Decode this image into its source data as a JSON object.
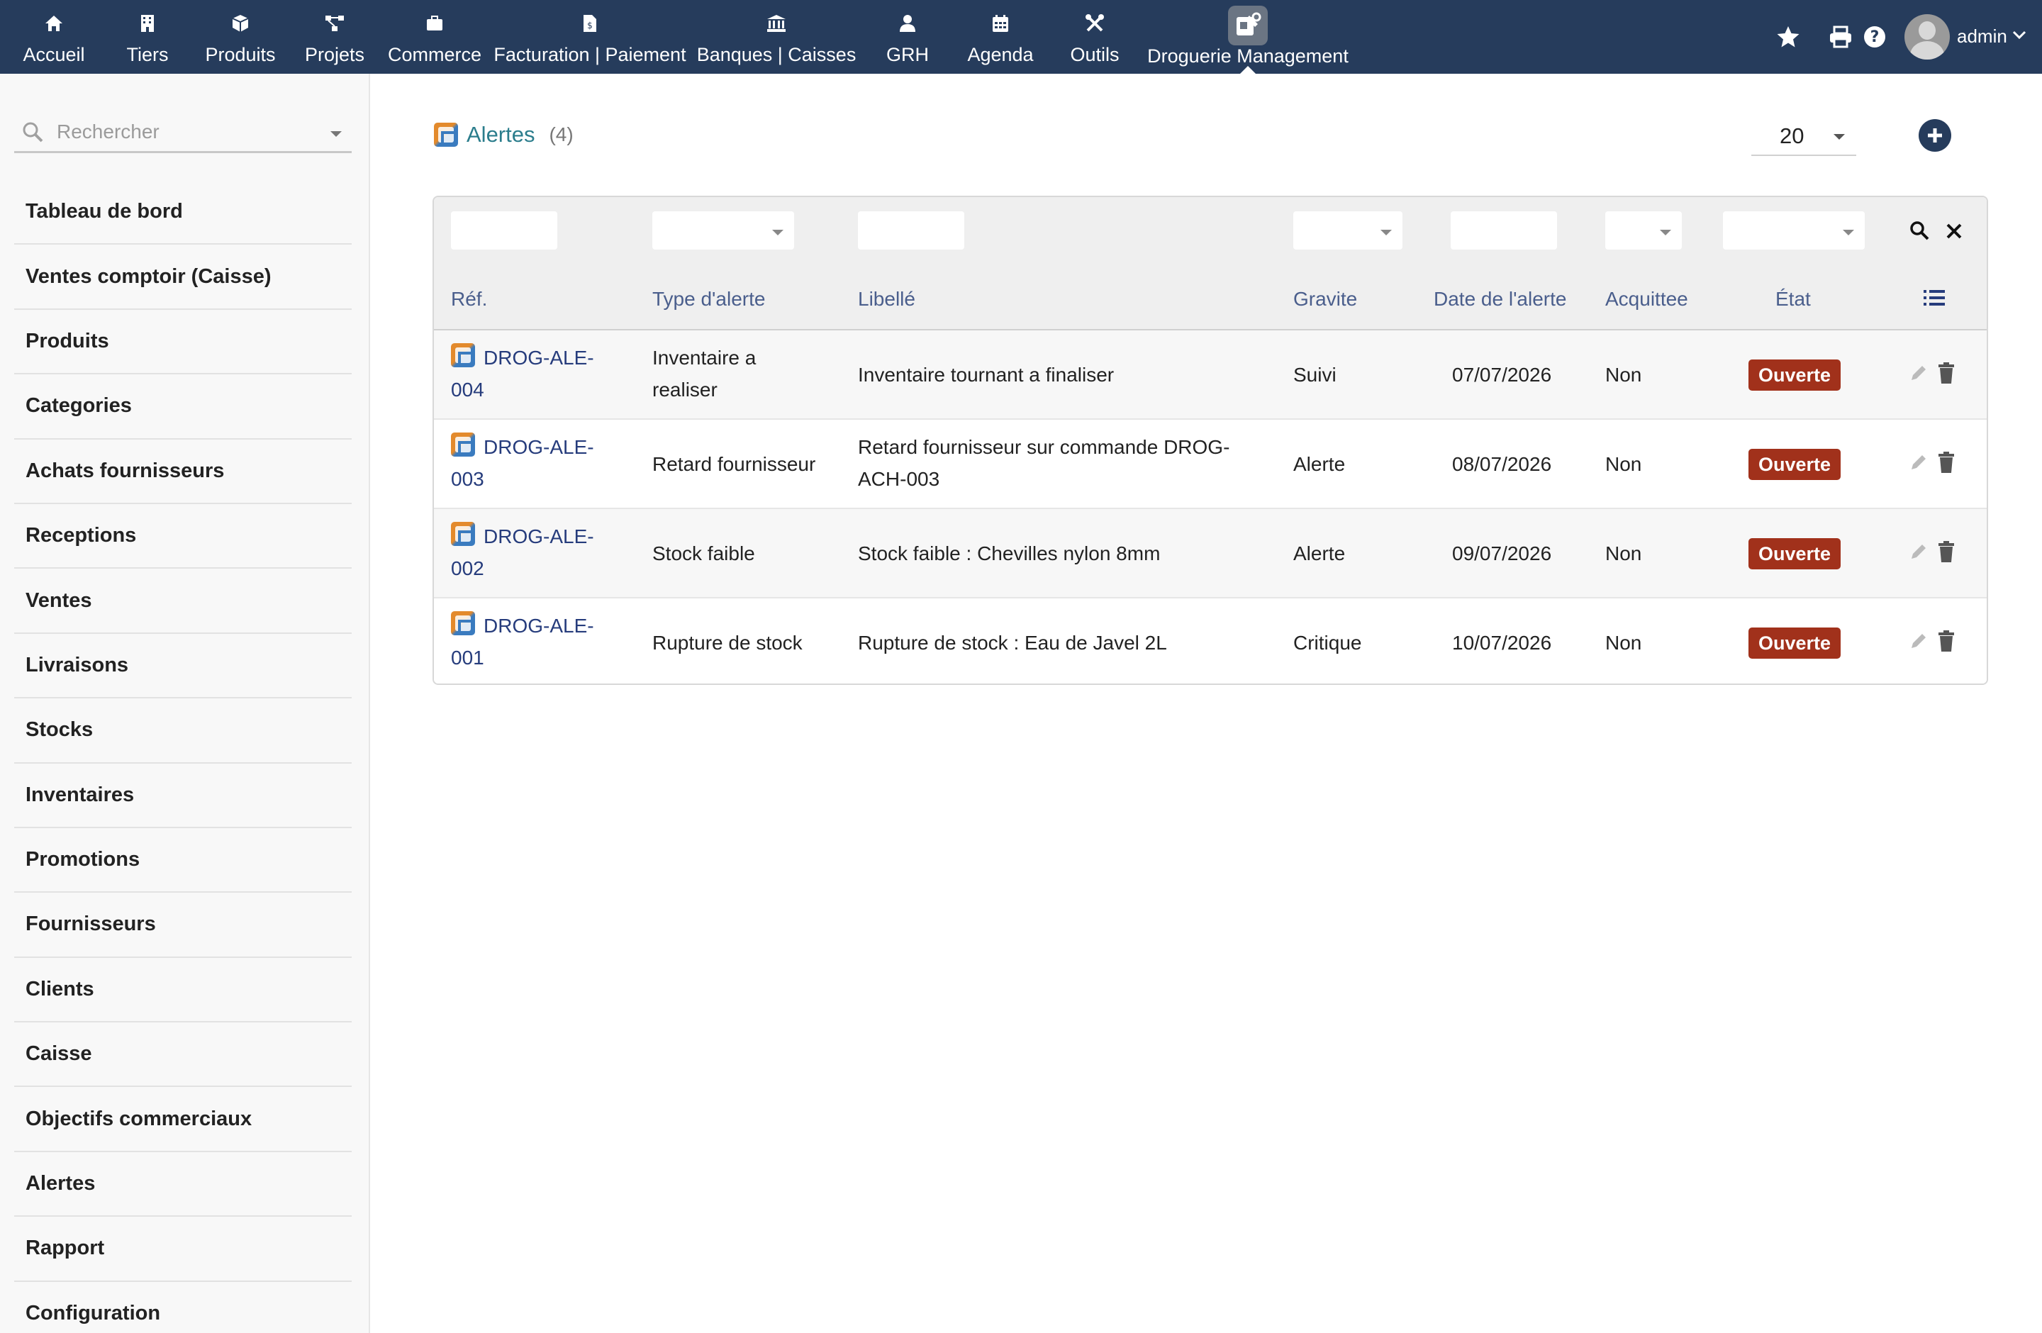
{
  "nav": [
    {
      "label": "Accueil",
      "icon": "home-icon"
    },
    {
      "label": "Tiers",
      "icon": "building-icon"
    },
    {
      "label": "Produits",
      "icon": "cube-icon"
    },
    {
      "label": "Projets",
      "icon": "project-icon"
    },
    {
      "label": "Commerce",
      "icon": "briefcase-icon"
    },
    {
      "label": "Facturation | Paiement",
      "icon": "invoice-icon"
    },
    {
      "label": "Banques | Caisses",
      "icon": "bank-icon"
    },
    {
      "label": "GRH",
      "icon": "user-icon"
    },
    {
      "label": "Agenda",
      "icon": "calendar-icon"
    },
    {
      "label": "Outils",
      "icon": "tools-icon"
    },
    {
      "label": "Droguerie Management",
      "icon": "droguerie-module-icon"
    }
  ],
  "user": {
    "name": "admin"
  },
  "sidebar": {
    "search_placeholder": "Rechercher",
    "items": [
      {
        "label": "Tableau de bord"
      },
      {
        "label": "Ventes comptoir (Caisse)"
      },
      {
        "label": "Produits"
      },
      {
        "label": "Categories"
      },
      {
        "label": "Achats fournisseurs"
      },
      {
        "label": "Receptions"
      },
      {
        "label": "Ventes"
      },
      {
        "label": "Livraisons"
      },
      {
        "label": "Stocks"
      },
      {
        "label": "Inventaires"
      },
      {
        "label": "Promotions"
      },
      {
        "label": "Fournisseurs"
      },
      {
        "label": "Clients"
      },
      {
        "label": "Caisse"
      },
      {
        "label": "Objectifs commerciaux"
      },
      {
        "label": "Alertes"
      },
      {
        "label": "Rapport"
      },
      {
        "label": "Configuration"
      }
    ]
  },
  "page": {
    "title": "Alertes",
    "count": "(4)",
    "page_size": "20"
  },
  "table": {
    "headers": {
      "ref": "Réf.",
      "type": "Type d'alerte",
      "libelle": "Libellé",
      "gravite": "Gravite",
      "date": "Date de l'alerte",
      "acquittee": "Acquittee",
      "etat": "État"
    },
    "rows": [
      {
        "ref_line1": "DROG-ALE-",
        "ref_line2": "004",
        "type_line1": "Inventaire a",
        "type_line2": "realiser",
        "libelle_line1": "Inventaire tournant a finaliser",
        "libelle_line2": "",
        "gravite": "Suivi",
        "date": "07/07/2026",
        "acquittee": "Non",
        "etat": "Ouverte"
      },
      {
        "ref_line1": "DROG-ALE-",
        "ref_line2": "003",
        "type_line1": "Retard fournisseur",
        "type_line2": "",
        "libelle_line1": "Retard fournisseur sur commande DROG-",
        "libelle_line2": "ACH-003",
        "gravite": "Alerte",
        "date": "08/07/2026",
        "acquittee": "Non",
        "etat": "Ouverte"
      },
      {
        "ref_line1": "DROG-ALE-",
        "ref_line2": "002",
        "type_line1": "Stock faible",
        "type_line2": "",
        "libelle_line1": "Stock faible : Chevilles nylon 8mm",
        "libelle_line2": "",
        "gravite": "Alerte",
        "date": "09/07/2026",
        "acquittee": "Non",
        "etat": "Ouverte"
      },
      {
        "ref_line1": "DROG-ALE-",
        "ref_line2": "001",
        "type_line1": "Rupture de stock",
        "type_line2": "",
        "libelle_line1": "Rupture de stock : Eau de Javel 2L",
        "libelle_line2": "",
        "gravite": "Critique",
        "date": "10/07/2026",
        "acquittee": "Non",
        "etat": "Ouverte"
      }
    ]
  },
  "colors": {
    "topbar": "#263c5c",
    "badge": "#a1311b",
    "link": "#263c7c",
    "title": "#2b7d8c"
  }
}
